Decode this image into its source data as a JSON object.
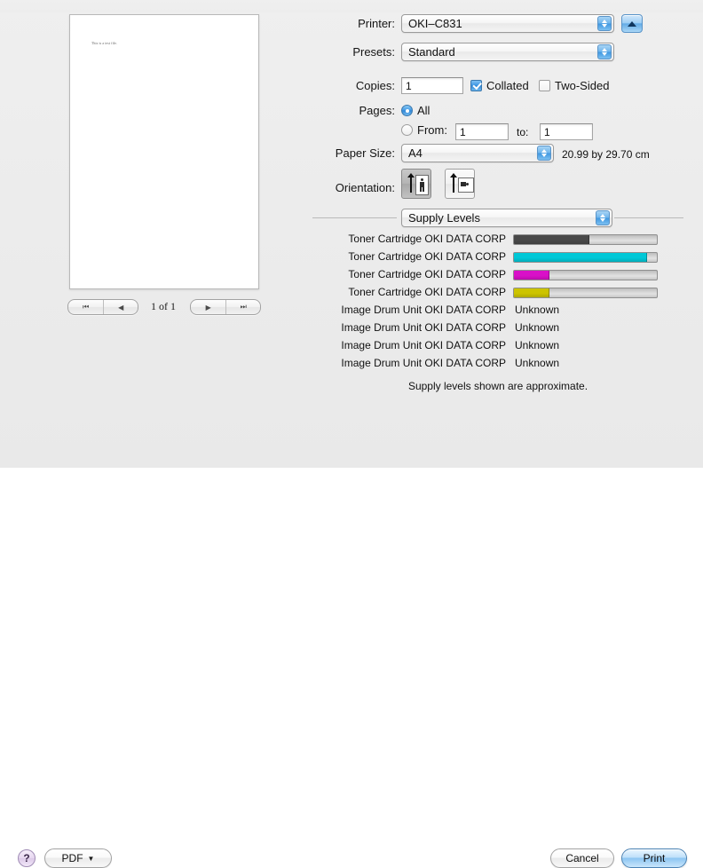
{
  "preview": {
    "page_text": "This is a test file.",
    "counter": "1 of 1",
    "nav": {
      "first_label": "⏮",
      "prev_label": "◀",
      "next_label": "▶",
      "last_label": "⏭"
    }
  },
  "fields": {
    "printer_label": "Printer:",
    "printer_value": "OKI–C831",
    "presets_label": "Presets:",
    "presets_value": "Standard",
    "copies_label": "Copies:",
    "copies_value": "1",
    "collated_label": "Collated",
    "collated_checked": true,
    "two_sided_label": "Two-Sided",
    "two_sided_checked": false,
    "pages_label": "Pages:",
    "pages_all_label": "All",
    "pages_all_selected": true,
    "pages_from_label": "From:",
    "pages_from_value": "1",
    "pages_to_label": "to:",
    "pages_to_value": "1",
    "paper_size_label": "Paper Size:",
    "paper_size_value": "A4",
    "paper_size_note": "20.99 by 29.70 cm",
    "orientation_label": "Orientation:",
    "orientation_selected": "portrait"
  },
  "pane": {
    "selected": "Supply Levels",
    "note": "Supply levels shown are approximate."
  },
  "supplies": [
    {
      "name": "Toner Cartridge OKI DATA CORP",
      "type": "bar",
      "level": 53,
      "color": "#484848"
    },
    {
      "name": "Toner Cartridge OKI DATA CORP",
      "type": "bar",
      "level": 93,
      "color": "#00c8d7"
    },
    {
      "name": "Toner Cartridge OKI DATA CORP",
      "type": "bar",
      "level": 25,
      "color": "#d910c8"
    },
    {
      "name": "Toner Cartridge OKI DATA CORP",
      "type": "bar",
      "level": 25,
      "color": "#ccc400"
    },
    {
      "name": "Image Drum Unit OKI DATA CORP",
      "type": "text",
      "value": "Unknown"
    },
    {
      "name": "Image Drum Unit OKI DATA CORP",
      "type": "text",
      "value": "Unknown"
    },
    {
      "name": "Image Drum Unit OKI DATA CORP",
      "type": "text",
      "value": "Unknown"
    },
    {
      "name": "Image Drum Unit OKI DATA CORP",
      "type": "text",
      "value": "Unknown"
    }
  ],
  "buttons": {
    "help_label": "?",
    "pdf_label": "PDF",
    "pdf_caret": "▼",
    "cancel_label": "Cancel",
    "print_label": "Print"
  },
  "colors": {
    "accent_blue": "#3a94e2",
    "default_button": "#8cc5f2",
    "sheet_bg": "#ededed"
  }
}
